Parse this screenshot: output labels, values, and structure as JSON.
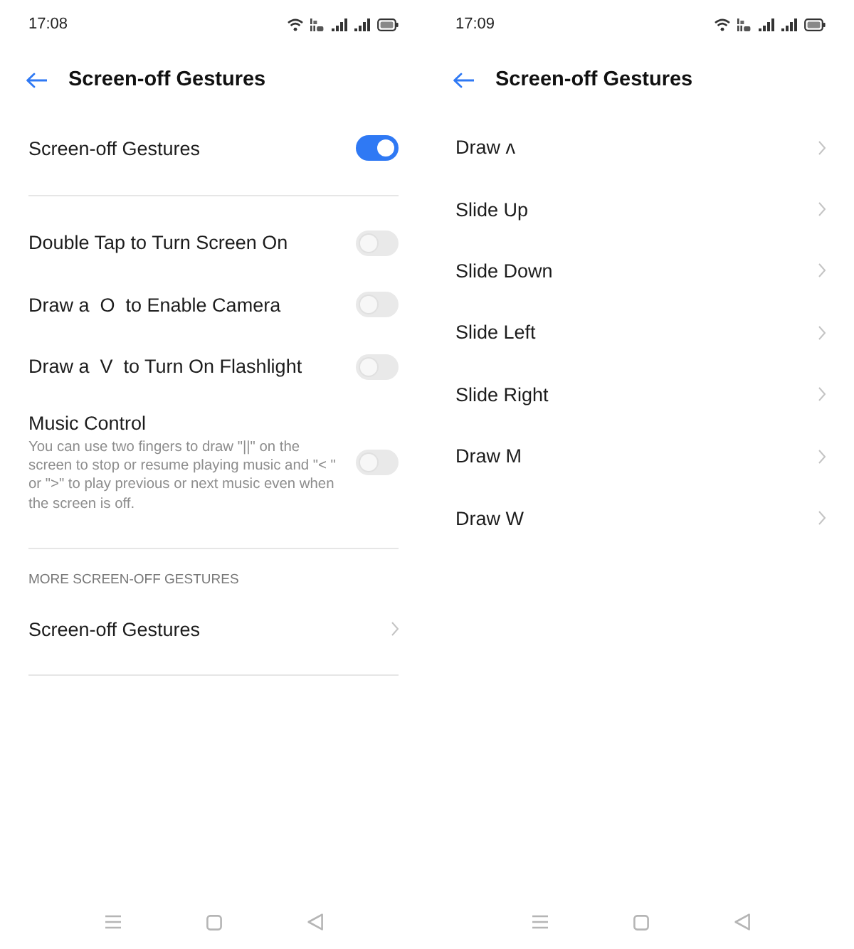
{
  "screens": [
    {
      "status_bar": {
        "time": "17:08"
      },
      "header": {
        "title": "Screen-off Gestures"
      },
      "master_switch": {
        "label": "Screen-off Gestures",
        "on": true
      },
      "switches": [
        {
          "label": "Double Tap to Turn Screen On",
          "on": false
        },
        {
          "label": "Draw a  O  to Enable Camera",
          "on": false
        },
        {
          "label": "Draw a  V  to Turn On Flashlight",
          "on": false
        },
        {
          "label": "Music Control",
          "description": "You can use two fingers to draw \"||\" on the screen to stop or resume playing music and \"< \" or \">\" to play previous or next music even when the screen is off.",
          "on": false
        }
      ],
      "more_section": {
        "title": "MORE SCREEN-OFF GESTURES",
        "items": [
          {
            "label": "Screen-off Gestures"
          }
        ]
      }
    },
    {
      "status_bar": {
        "time": "17:09"
      },
      "header": {
        "title": "Screen-off Gestures"
      },
      "items": [
        {
          "label": "Draw ʌ"
        },
        {
          "label": "Slide Up"
        },
        {
          "label": "Slide Down"
        },
        {
          "label": "Slide Left"
        },
        {
          "label": "Slide Right"
        },
        {
          "label": "Draw M"
        },
        {
          "label": "Draw W"
        }
      ]
    }
  ]
}
